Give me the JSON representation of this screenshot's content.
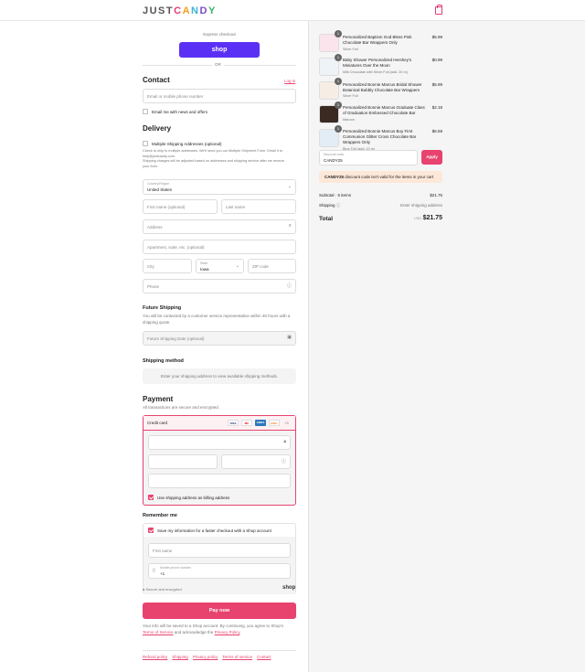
{
  "header": {
    "logo_parts": [
      "JUST",
      "C",
      "A",
      "N",
      "D",
      "Y"
    ]
  },
  "express": {
    "label": "Express checkout",
    "shop_button": "shop",
    "or": "OR"
  },
  "contact": {
    "title": "Contact",
    "login": "Log in",
    "email_placeholder": "Email or mobile phone number",
    "email_news": "Email me with news and offers"
  },
  "delivery": {
    "title": "Delivery",
    "multi_label": "Multiple Shipping Addresses (optional)",
    "multi_note_1": "Check to ship to multiple addresses. We'll send you our Multiple Shipment Form. Email it to",
    "multi_note_2": "help@justcandy.com.",
    "multi_note_3": "Shipping charges will be adjusted based on addresses and shipping service after we receive",
    "multi_note_4": "your form.",
    "country_label": "Country/Region",
    "country_value": "United States",
    "first_name": "First name (optional)",
    "last_name": "Last name",
    "address": "Address",
    "apartment": "Apartment, suite, etc. (optional)",
    "city": "City",
    "state_label": "State",
    "state_value": "Iowa",
    "zip": "ZIP code",
    "phone": "Phone"
  },
  "future": {
    "title": "Future Shipping",
    "text_1": "You will be contacted by a customer service representative within 48 hours with a",
    "text_2": "shipping quote.",
    "date_placeholder": "Future Shipping Date (optional)"
  },
  "shipping_method": {
    "title": "Shipping method",
    "note": "Enter your shipping address to view available shipping methods."
  },
  "payment": {
    "title": "Payment",
    "subtitle": "All transactions are secure and encrypted.",
    "credit_card": "Credit card",
    "more_cards": "+3",
    "cards": [
      {
        "name": "VISA",
        "color": "#1a1f71"
      },
      {
        "name": "MC",
        "color": "#eb001b"
      },
      {
        "name": "AMEX",
        "color": "#2e77bb"
      },
      {
        "name": "DISC",
        "color": "#f58220"
      }
    ],
    "billing": "Use shipping address as billing address"
  },
  "remember": {
    "title": "Remember me",
    "save_info": "Save my information for a faster checkout with a Shop account",
    "first_name": "First name",
    "mobile_label": "Mobile phone number",
    "mobile_prefix": "+1",
    "secure": "Secure and encrypted",
    "shop": "shop"
  },
  "pay_now": "Pay now",
  "terms": {
    "line_1": "Your info will be saved to a Shop account. By continuing, you agree to Shop's",
    "terms_link": "Terms of Service",
    "and": "and acknowledge the",
    "privacy_link": "Privacy Policy",
    "period": "."
  },
  "footer_links": [
    "Refund policy",
    "Shipping",
    "Privacy policy",
    "Terms of service",
    "Contact"
  ],
  "cart": {
    "items": [
      {
        "qty": "1",
        "name_1": "Personalized Baptism God Bless Pink",
        "name_2": "Chocolate Bar Wrappers Only",
        "name_3": "",
        "variant": "Silver Foil",
        "price": "$5.99"
      },
      {
        "qty": "1",
        "name_1": "Baby Shower Personalized Hershey's",
        "name_2": "Miniatures Over the Moon",
        "name_3": "",
        "variant": "Milk Chocolate with Silver Foil (add. 20 m)",
        "price": "$0.99"
      },
      {
        "qty": "1",
        "name_1": "Personalized Bonnie Marcus Bridal Shower",
        "name_2": "Botanical Bubbly Chocolate Bar Wrappers",
        "name_3": "",
        "variant": "Silver Foil",
        "price": "$5.99"
      },
      {
        "qty": "1",
        "name_1": "Personalized Bonnie Marcus Graduate Class",
        "name_2": "of Graduation Embossed Chocolate Bar",
        "name_3": "",
        "variant": "Maroon",
        "price": "$2.19"
      },
      {
        "qty": "1",
        "name_1": "Personalized Bonnie Marcus Boy First",
        "name_2": "Communion Glitter Cross Chocolate Bar",
        "name_3": "Wrappers Only",
        "variant": "Blue Foil (add. 10 m)",
        "price": "$6.59"
      }
    ],
    "discount_label": "Discount code",
    "discount_value": "CANDY25",
    "apply": "Apply",
    "warn_code": "CANDY25",
    "warn_text": "discount code isn't valid for the items in your cart",
    "subtotal_label": "Subtotal · 5 items",
    "subtotal_value": "$21.75",
    "shipping_label": "Shipping",
    "shipping_value": "Enter shipping address",
    "total_label": "Total",
    "currency": "USD",
    "total_value": "$21.75"
  }
}
